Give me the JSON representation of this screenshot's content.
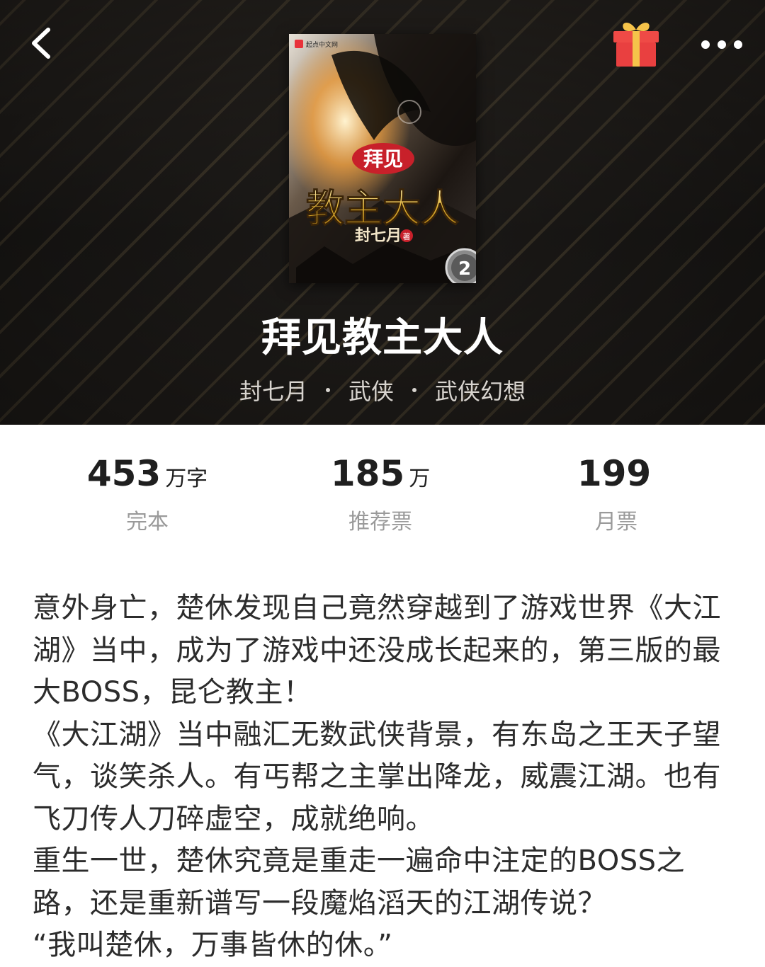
{
  "topbar": {
    "back_icon": "back-chevron-icon",
    "gift_icon": "gift-icon",
    "more_icon": "more-dots-icon",
    "gift_colors": {
      "box": "#e94040",
      "ribbon": "#f5c34a"
    }
  },
  "cover": {
    "publisher_badge": "起点中文网",
    "title_top": "拜见",
    "title_main": "教主大人",
    "author": "封七月",
    "author_suffix": "著",
    "volume_badge": "2"
  },
  "book": {
    "title": "拜见教主大人",
    "author": "封七月",
    "category": "武侠",
    "subcategory": "武侠幻想"
  },
  "stats": [
    {
      "value": "453",
      "unit": "万字",
      "label": "完本"
    },
    {
      "value": "185",
      "unit": "万",
      "label": "推荐票"
    },
    {
      "value": "199",
      "unit": "",
      "label": "月票"
    }
  ],
  "synopsis": [
    "意外身亡，楚休发现自己竟然穿越到了游戏世界《大江湖》当中，成为了游戏中还没成长起来的，第三版的最大BOSS，昆仑教主！",
    "《大江湖》当中融汇无数武侠背景，有东岛之王天子望气，谈笑杀人。有丐帮之主掌出降龙，威震江湖。也有飞刀传人刀碎虚空，成就绝响。",
    "重生一世，楚休究竟是重走一遍命中注定的BOSS之路，还是重新谱写一段魔焰滔天的江湖传说？",
    "“我叫楚休，万事皆休的休。”"
  ]
}
